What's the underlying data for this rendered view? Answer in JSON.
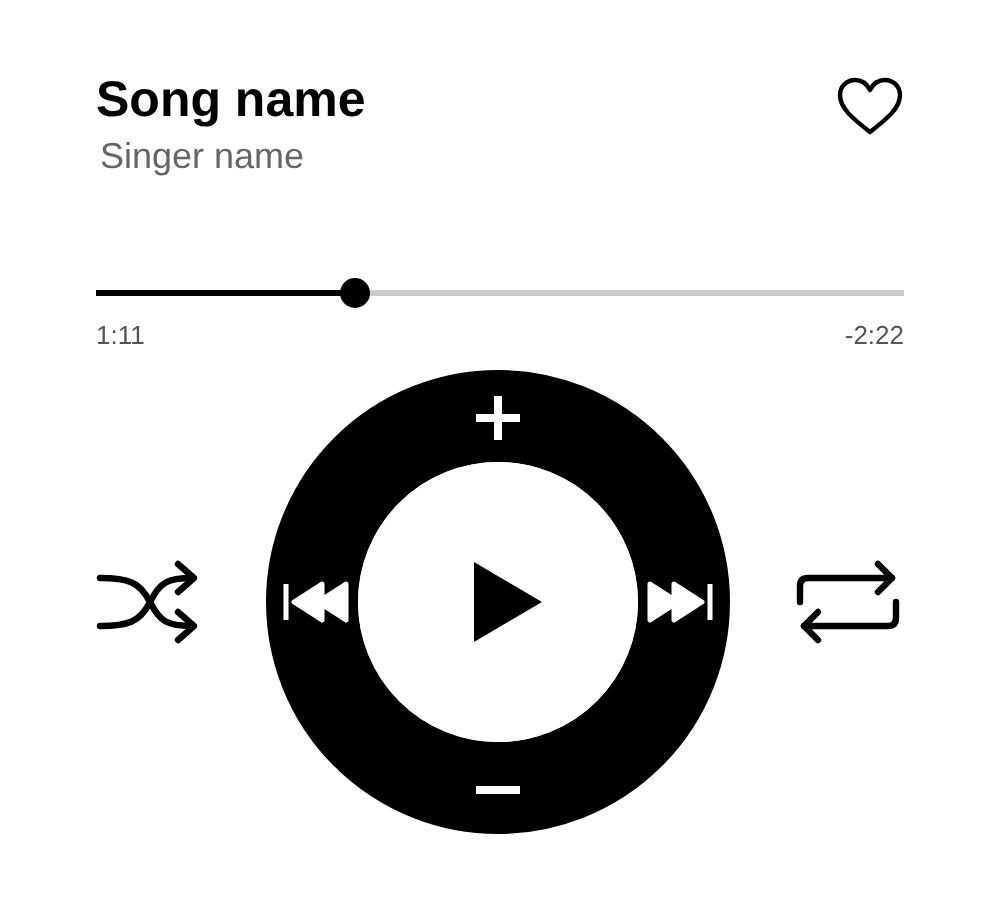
{
  "track": {
    "title": "Song name",
    "artist": "Singer name",
    "favorite": false
  },
  "progress": {
    "level": 0.32,
    "elapsed": "1:11",
    "remaining": "-2:22"
  }
}
